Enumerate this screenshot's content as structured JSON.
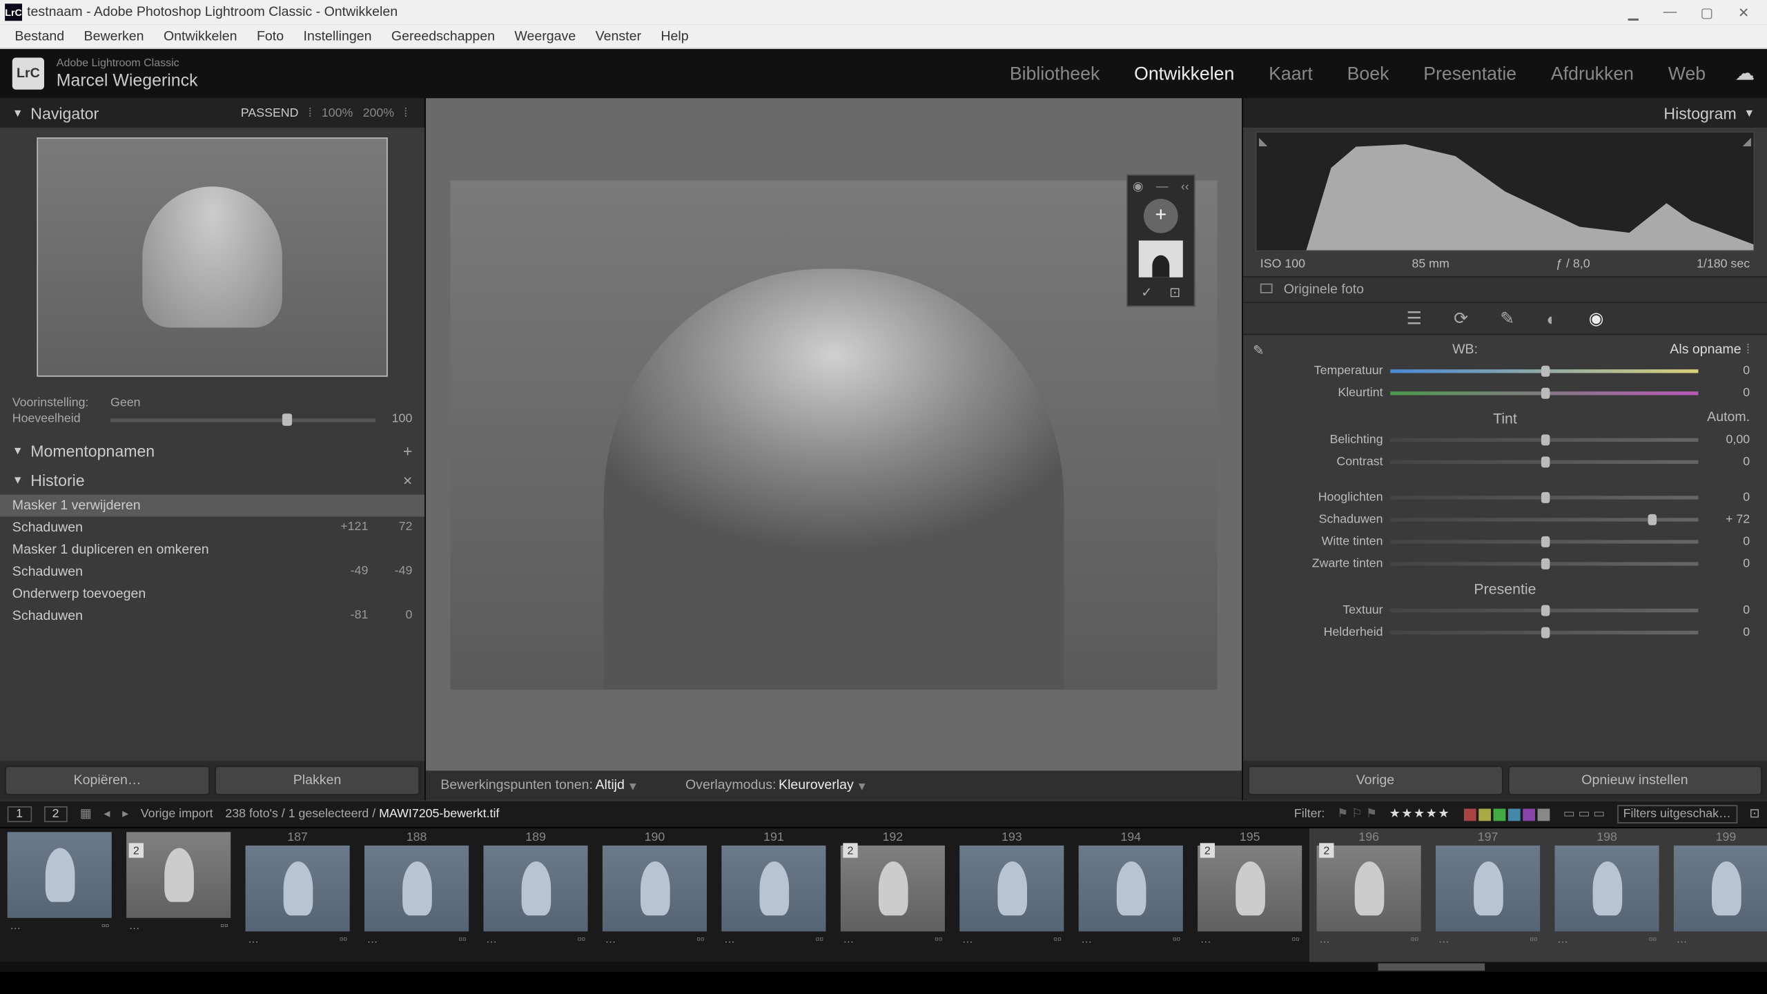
{
  "titlebar": {
    "app_icon": "LrC",
    "title": "testnaam - Adobe Photoshop Lightroom Classic - Ontwikkelen"
  },
  "menubar": [
    "Bestand",
    "Bewerken",
    "Ontwikkelen",
    "Foto",
    "Instellingen",
    "Gereedschappen",
    "Weergave",
    "Venster",
    "Help"
  ],
  "header": {
    "logo": "LrC",
    "brand": "Adobe Lightroom Classic",
    "name": "Marcel Wiegerinck",
    "modules": [
      "Bibliotheek",
      "Ontwikkelen",
      "Kaart",
      "Boek",
      "Presentatie",
      "Afdrukken",
      "Web"
    ],
    "active": "Ontwikkelen"
  },
  "navigator": {
    "title": "Navigator",
    "fit": "PASSEND",
    "z100": "100%",
    "z200": "200%"
  },
  "presets": {
    "label": "Voorinstelling:",
    "value": "Geen",
    "amount_label": "Hoeveelheid",
    "amount": "100"
  },
  "snapshots": {
    "title": "Momentopnamen"
  },
  "history": {
    "title": "Historie",
    "items": [
      {
        "name": "Masker 1 verwijderen",
        "v1": "",
        "v2": ""
      },
      {
        "name": "Schaduwen",
        "v1": "+121",
        "v2": "72"
      },
      {
        "name": "Masker 1 dupliceren en omkeren",
        "v1": "",
        "v2": ""
      },
      {
        "name": "Schaduwen",
        "v1": "-49",
        "v2": "-49"
      },
      {
        "name": "Onderwerp toevoegen",
        "v1": "",
        "v2": ""
      },
      {
        "name": "Schaduwen",
        "v1": "-81",
        "v2": "0"
      }
    ]
  },
  "leftbtns": {
    "copy": "Kopiëren…",
    "paste": "Plakken"
  },
  "centerfoot": {
    "edit_points": "Bewerkingspunten tonen:",
    "edit_points_v": "Altijd",
    "overlay": "Overlaymodus:",
    "overlay_v": "Kleuroverlay"
  },
  "righthead": {
    "title": "Histogram"
  },
  "histo_meta": {
    "iso": "ISO 100",
    "focal": "85 mm",
    "ap": "ƒ / 8,0",
    "sh": "1/180 sec"
  },
  "orig": {
    "label": "Originele foto"
  },
  "basic": {
    "wb_label": "WB:",
    "wb_value": "Als opname",
    "sliders": [
      {
        "lbl": "Temperatuur",
        "val": "0",
        "cls": "temp"
      },
      {
        "lbl": "Kleurtint",
        "val": "0",
        "cls": "tint"
      }
    ],
    "tint_head": "Tint",
    "autom": "Autom.",
    "tone": [
      {
        "lbl": "Belichting",
        "val": "0,00"
      },
      {
        "lbl": "Contrast",
        "val": "0"
      }
    ],
    "tone2": [
      {
        "lbl": "Hooglichten",
        "val": "0"
      },
      {
        "lbl": "Schaduwen",
        "val": "+ 72",
        "knob": 85
      },
      {
        "lbl": "Witte tinten",
        "val": "0"
      },
      {
        "lbl": "Zwarte tinten",
        "val": "0"
      }
    ],
    "pres_head": "Presentie",
    "pres": [
      {
        "lbl": "Textuur",
        "val": "0"
      },
      {
        "lbl": "Helderheid",
        "val": "0"
      }
    ]
  },
  "rbtns": {
    "prev": "Vorige",
    "reset": "Opnieuw instellen"
  },
  "toolbar": {
    "pg1": "1",
    "pg2": "2",
    "vorige": "Vorige import",
    "count": "238 foto's / 1 geselecteerd /",
    "file": "MAWI7205-bewerkt.tif",
    "filter": "Filter:",
    "filters_off": "Filters uitgeschak…"
  },
  "film_numbers": [
    "",
    "",
    "187",
    "188",
    "189",
    "190",
    "191",
    "192",
    "193",
    "194",
    "195",
    "196",
    "197",
    "198",
    "199",
    ""
  ],
  "film_badges": {
    "1": "2",
    "7": "2",
    "10": "2",
    "11": "2"
  },
  "film_bw": [
    1,
    7,
    10,
    11
  ],
  "film_sel": 11
}
